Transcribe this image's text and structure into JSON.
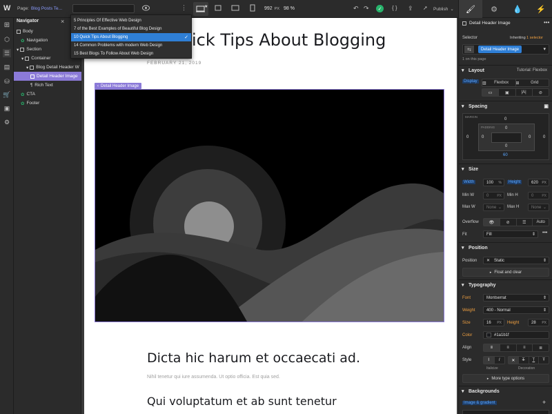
{
  "topbar": {
    "logo": "W",
    "page_label": "Page:",
    "page_name": "Blog Posts Te...",
    "width_value": "992",
    "width_unit": "PX",
    "zoom": "98 %",
    "publish_label": "Publish"
  },
  "collection_dropdown": {
    "items": [
      "5 Principles Of Effective Web Design",
      "7 of the Best Examples of Beautiful Blog Design",
      "10 Quick Tips About Blogging",
      "14 Common Problems with modern Web Design",
      "15 Best Blogs To Follow About Web Design"
    ],
    "selected_index": 2
  },
  "navigator": {
    "title": "Navigator",
    "tree": [
      {
        "label": "Body"
      },
      {
        "label": "Navigation"
      },
      {
        "label": "Section"
      },
      {
        "label": "Container"
      },
      {
        "label": "Blog Detail Header W"
      },
      {
        "label": "Detail Header Image"
      },
      {
        "label": "Rich Text"
      },
      {
        "label": "CTA"
      },
      {
        "label": "Footer"
      }
    ]
  },
  "canvas": {
    "title_visible": "ick Tips About Blogging",
    "date": "FEBRUARY 21, 2019",
    "selected_tag": "Detail Header Image",
    "heading1": "Dicta hic harum et occaecati ad.",
    "paragraph1": "Nihil tenetur qui iure assumenda. Ut optio officia. Est quia sed.",
    "heading2": "Qui voluptatum et ab sunt tenetur"
  },
  "panel": {
    "element_name": "Detail Header Image",
    "selector_label": "Selector",
    "inheriting_label": "Inheriting",
    "inheriting_count": "1 selector",
    "selector_chip": "Detail Header Image",
    "on_this_page": "1 on this page",
    "layout": {
      "title": "Layout",
      "tutorial": "Tutorial: Flexbox",
      "display_label": "Display",
      "flexbox": "Flexbox",
      "grid": "Grid"
    },
    "spacing": {
      "title": "Spacing",
      "margin_label": "MARGIN",
      "padding_label": "PADDING",
      "margin_top": "0",
      "margin_left": "0",
      "margin_right": "0",
      "margin_bottom": "60",
      "padding_top": "0",
      "padding_left": "0",
      "padding_right": "0",
      "padding_bottom": "0"
    },
    "size": {
      "title": "Size",
      "width_label": "Width",
      "width_value": "100",
      "width_unit": "%",
      "height_label": "Height",
      "height_value": "620",
      "height_unit": "PX",
      "minw_label": "Min W",
      "minw_value": "0",
      "minw_unit": "PX",
      "minh_label": "Min H",
      "minh_value": "0",
      "minh_unit": "PX",
      "maxw_label": "Max W",
      "maxw_value": "None",
      "maxh_label": "Max H",
      "maxh_value": "None",
      "overflow_label": "Overflow",
      "overflow_auto": "Auto",
      "fit_label": "Fit",
      "fit_value": "Fill"
    },
    "position": {
      "title": "Position",
      "label": "Position",
      "value": "Static",
      "float_label": "Float and clear"
    },
    "typography": {
      "title": "Typography",
      "font_label": "Font",
      "font_value": "Montserrat",
      "weight_label": "Weight",
      "weight_value": "400 - Normal",
      "size_label": "Size",
      "size_value": "16",
      "size_unit": "PX",
      "height_label": "Height",
      "height_value": "28",
      "height_unit": "PX",
      "color_label": "Color",
      "color_value": "#1a1b1f",
      "align_label": "Align",
      "style_label": "Style",
      "italicize": "Italicize",
      "decoration": "Decoration",
      "more_options": "More type options"
    },
    "backgrounds": {
      "title": "Backgrounds",
      "chip": "Image & gradient"
    }
  },
  "colors": {
    "accent": "#8b7ad8",
    "blue": "#2f7fd6",
    "green": "#27b36b"
  }
}
